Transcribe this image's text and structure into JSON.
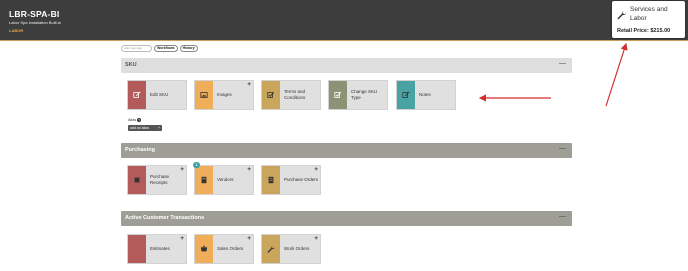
{
  "header": {
    "sku_code": "LBR-SPA-BI",
    "description": "Labor Spa Installation Built-In",
    "category": "LABOR",
    "background_color": "#3d3d3d"
  },
  "service_card": {
    "icon": "wrench-icon",
    "title": "Services and Labor",
    "price": "Retail Price: $215.00"
  },
  "tags": {
    "input_placeholder": "Add new tags",
    "items": [
      "Workflows",
      "History"
    ]
  },
  "sections": [
    {
      "title": "SKU",
      "collapse": "—",
      "tiles": [
        {
          "label": "Edit SKU",
          "icon": "edit-icon",
          "color": "#b35a5a",
          "plus": ""
        },
        {
          "label": "Images",
          "icon": "image-icon",
          "color": "#f0ad5a",
          "plus": "+"
        },
        {
          "label": "Terms and Conditions",
          "icon": "checklist-icon",
          "color": "#c9a65c",
          "plus": ""
        },
        {
          "label": "Change SKU Type",
          "icon": "change-type-icon",
          "color": "#8a9474",
          "plus": ""
        },
        {
          "label": "Notes",
          "icon": "notes-icon",
          "color": "#4aa3a3",
          "plus": ""
        }
      ],
      "alias": {
        "label": "Alias",
        "help": "?",
        "button": "add an alias",
        "button_plus": "+"
      }
    },
    {
      "title": "Purchasing",
      "collapse": "—",
      "tiles": [
        {
          "label": "Purchase Receipts",
          "icon": "receipt-icon",
          "color": "#b35a5a",
          "plus": "+"
        },
        {
          "label": "Vendors",
          "icon": "vendor-icon",
          "color": "#f0ad5a",
          "plus": "+",
          "badge": "1"
        },
        {
          "label": "Purchase Orders",
          "icon": "purchase-orders-icon",
          "color": "#c9a65c",
          "plus": "+"
        }
      ]
    },
    {
      "title": "Active Customer Transactions",
      "collapse": "—",
      "tiles": [
        {
          "label": "Estimates",
          "icon": "estimate-icon",
          "color": "#b35a5a",
          "plus": "+"
        },
        {
          "label": "Sales Orders",
          "icon": "sales-orders-icon",
          "color": "#f0ad5a",
          "plus": "+"
        },
        {
          "label": "Work Orders",
          "icon": "wrench-icon",
          "color": "#c9a65c",
          "plus": "+"
        }
      ]
    }
  ],
  "annotation_color": "#d32f2f"
}
